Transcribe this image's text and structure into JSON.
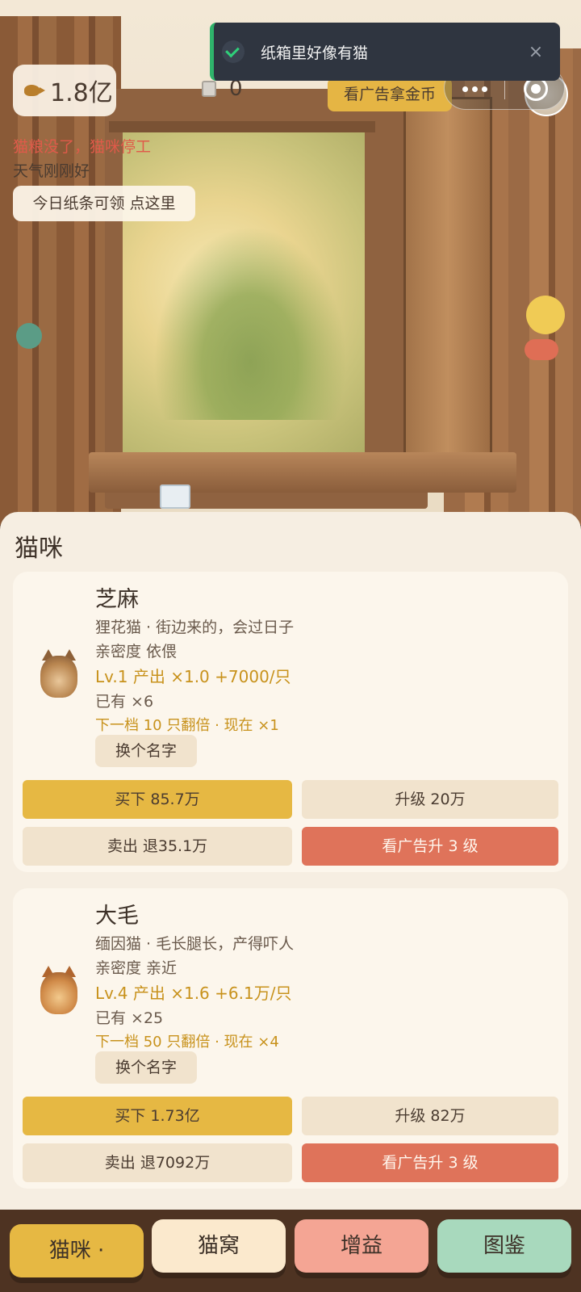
{
  "toast": {
    "text": "纸箱里好像有猫",
    "close": "×"
  },
  "hud": {
    "coins": "1.8亿",
    "boxes": "0",
    "ad_coin_label": "看广告拿金币",
    "status_warning": "猫粮没了，猫咪停工",
    "weather": "天气刚刚好",
    "note_label": "今日纸条可领  点这里"
  },
  "panel": {
    "title": "猫咪",
    "cats": [
      {
        "name": "芝麻",
        "desc": "狸花猫  ·  街边来的，会过日子",
        "affinity": "亲密度  依偎",
        "level": "Lv.1  产出 ×1.0  +7000/只",
        "owned": "已有 ×6",
        "next": "下一档 10 只翻倍 · 现在 ×1",
        "rename": "换个名字",
        "buy": "买下  85.7万",
        "upgrade": "升级  20万",
        "sell": "卖出  退35.1万",
        "ad_upgrade": "看广告升 3 级"
      },
      {
        "name": "大毛",
        "desc": "缅因猫  ·  毛长腿长，产得吓人",
        "affinity": "亲密度  亲近",
        "level": "Lv.4  产出 ×1.6  +6.1万/只",
        "owned": "已有 ×25",
        "next": "下一档 50 只翻倍 · 现在 ×4",
        "rename": "换个名字",
        "buy": "买下  1.73亿",
        "upgrade": "升级  82万",
        "sell": "卖出  退7092万",
        "ad_upgrade": "看广告升 3 级"
      }
    ]
  },
  "nav": {
    "tabs": [
      {
        "label": "猫咪 ·"
      },
      {
        "label": "猫窝"
      },
      {
        "label": "增益"
      },
      {
        "label": "图鉴"
      }
    ]
  },
  "icons": [
    "fish-coin-icon",
    "box-icon",
    "more-icon",
    "close-circle-icon",
    "check-icon",
    "close-icon"
  ],
  "colors": {
    "accent": "#e6b843",
    "ad_red": "#df735a",
    "warning": "#e05a4a",
    "panel_bg": "#f6eee2",
    "nav_bg": "#4e3322"
  }
}
